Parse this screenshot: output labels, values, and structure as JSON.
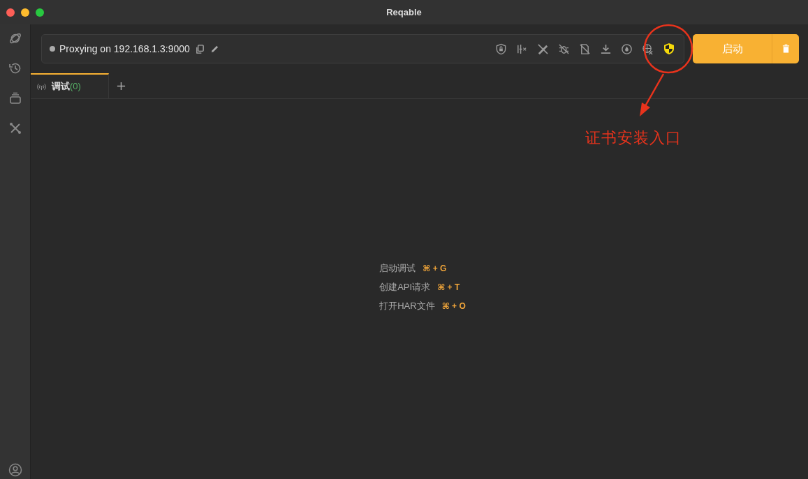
{
  "window": {
    "title": "Reqable"
  },
  "proxy_bar": {
    "status": "Proxying on 192.168.1.3:9000"
  },
  "start_button": {
    "label": "启动"
  },
  "tabs": [
    {
      "label": "调试",
      "count": "(0)",
      "selected": true
    }
  ],
  "shortcuts": [
    {
      "label": "启动调试",
      "keys": "⌘ + G"
    },
    {
      "label": "创建API请求",
      "keys": "⌘ + T"
    },
    {
      "label": "打开HAR文件",
      "keys": "⌘ + O"
    }
  ],
  "annotation": {
    "text": "证书安装入口"
  }
}
